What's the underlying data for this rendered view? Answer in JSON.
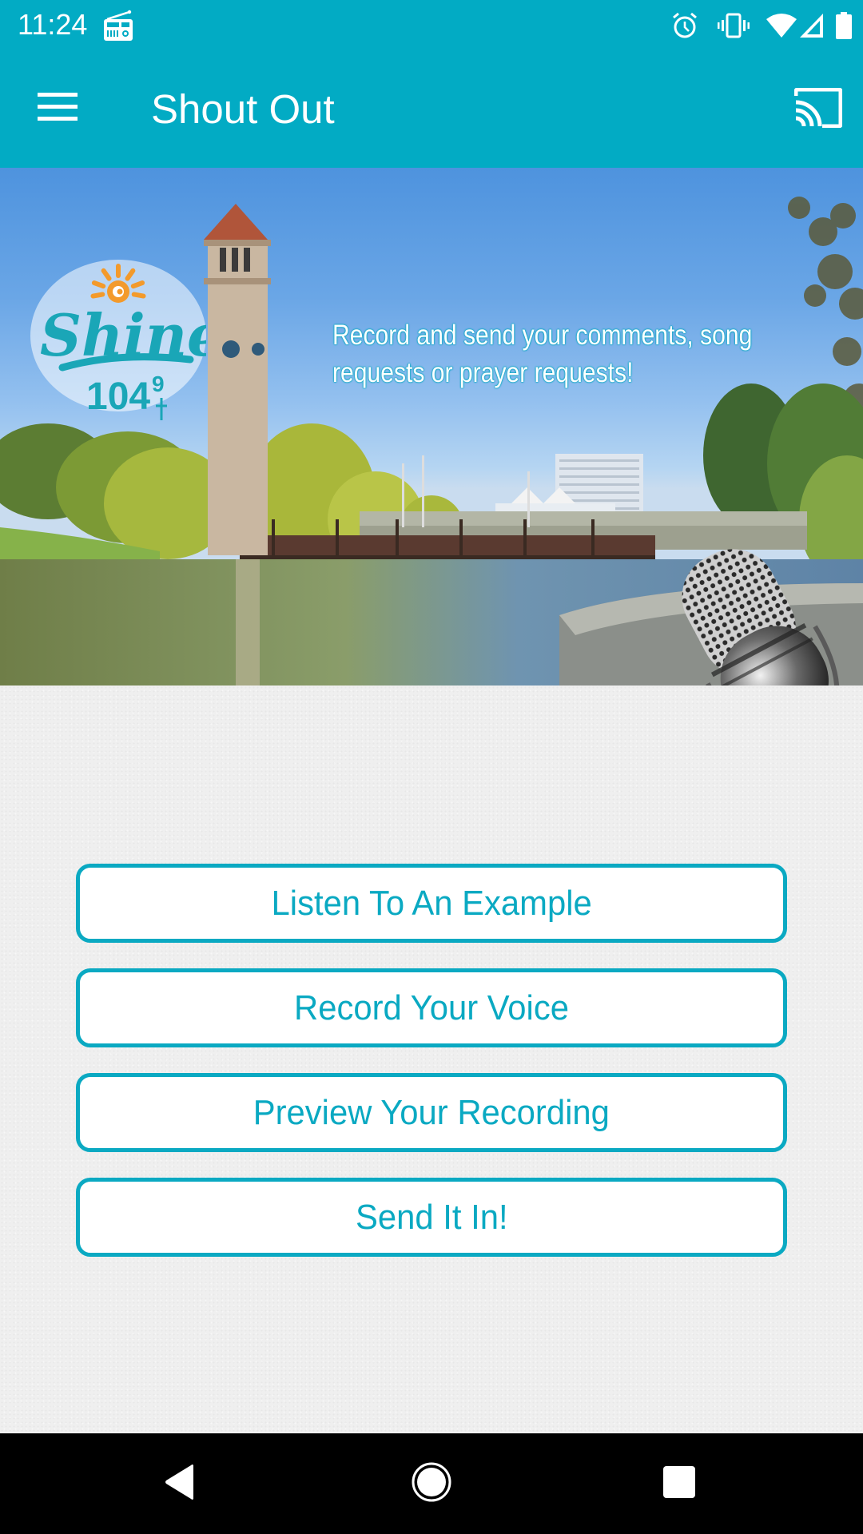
{
  "status_bar": {
    "time": "11:24",
    "left_icons": [
      "radio-icon"
    ],
    "right_icons": [
      "alarm-icon",
      "vibrate-icon",
      "wifi-icon",
      "cell-signal-icon",
      "battery-icon"
    ]
  },
  "app_bar": {
    "title": "Shout Out",
    "menu_icon": "hamburger-menu-icon",
    "cast_icon": "cast-icon"
  },
  "banner": {
    "logo_text": "Shine",
    "logo_frequency": "104",
    "logo_frequency_decimal": "9",
    "tagline": "Record and send your comments, song requests or prayer requests!",
    "colors": {
      "logo_teal": "#1aa6b7",
      "logo_orange": "#f39a2b"
    }
  },
  "actions": {
    "buttons": [
      {
        "label": "Listen To An Example"
      },
      {
        "label": "Record Your Voice"
      },
      {
        "label": "Preview Your Recording"
      },
      {
        "label": "Send It In!"
      }
    ]
  },
  "nav_bar": {
    "back_icon": "back-triangle-icon",
    "home_icon": "home-circle-icon",
    "recents_icon": "recents-square-icon"
  },
  "theme": {
    "primary": "#02abc4",
    "button_border": "#0aa9c2",
    "button_text": "#0aa9c2",
    "background": "#efefef"
  }
}
